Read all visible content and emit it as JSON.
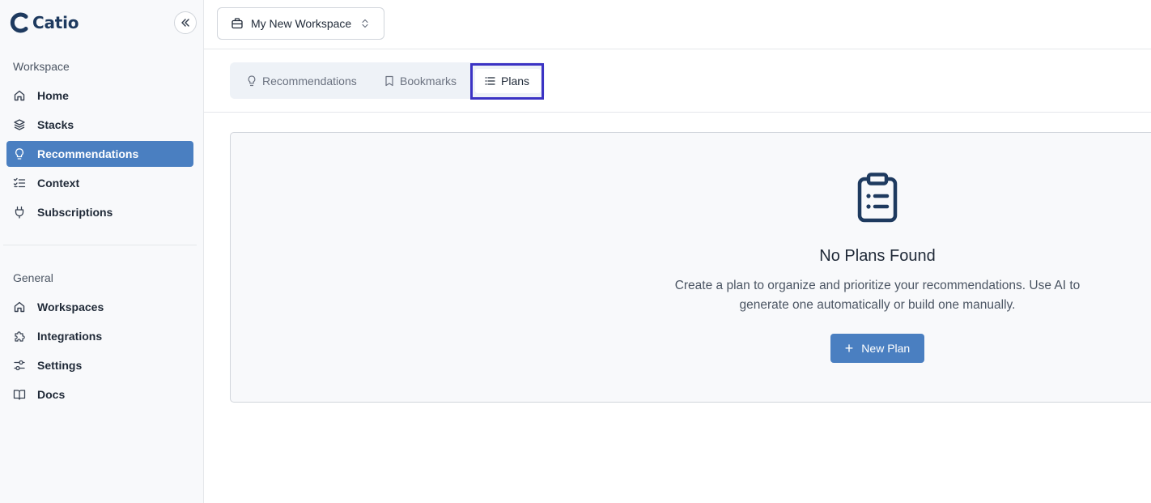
{
  "app": {
    "name": "Catio",
    "brand_color": "#1e3a5f",
    "accent_color": "#4a7fc1",
    "highlight_color": "#3b33c4"
  },
  "sidebar": {
    "workspace_section_label": "Workspace",
    "workspace_items": [
      {
        "label": "Home",
        "icon": "home-icon"
      },
      {
        "label": "Stacks",
        "icon": "layers-icon"
      },
      {
        "label": "Recommendations",
        "icon": "lightbulb-icon",
        "active": true
      },
      {
        "label": "Context",
        "icon": "checklist-icon"
      },
      {
        "label": "Subscriptions",
        "icon": "plug-icon"
      }
    ],
    "general_section_label": "General",
    "general_items": [
      {
        "label": "Workspaces",
        "icon": "home-icon"
      },
      {
        "label": "Integrations",
        "icon": "puzzle-icon"
      },
      {
        "label": "Settings",
        "icon": "sliders-icon"
      },
      {
        "label": "Docs",
        "icon": "book-icon"
      }
    ]
  },
  "topbar": {
    "workspace_selector": "My New Workspace"
  },
  "tabs": [
    {
      "label": "Recommendations",
      "icon": "lightbulb-icon"
    },
    {
      "label": "Bookmarks",
      "icon": "bookmark-icon"
    },
    {
      "label": "Plans",
      "icon": "list-icon",
      "active": true
    }
  ],
  "empty_state": {
    "icon": "clipboard-list-icon",
    "title": "No Plans Found",
    "description": "Create a plan to organize and prioritize your recommendations. Use AI to generate one automatically or build one manually.",
    "button_label": "New Plan"
  }
}
